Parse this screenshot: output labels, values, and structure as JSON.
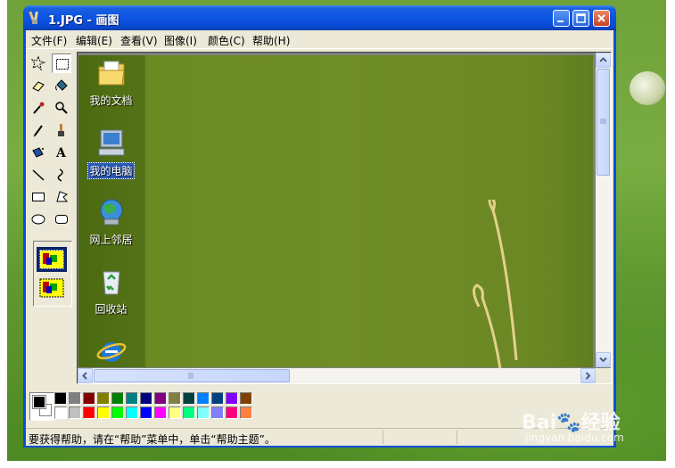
{
  "window": {
    "title": "1.JPG - 画图",
    "controls": {
      "minimize": "minimize",
      "maximize": "maximize",
      "close": "close"
    }
  },
  "menu": {
    "items": [
      "文件(F)",
      "编辑(E)",
      "查看(V)",
      "图像(I)",
      "颜色(C)",
      "帮助(H)"
    ]
  },
  "toolbox": {
    "tools": [
      "free-select-icon",
      "rect-select-icon",
      "eraser-icon",
      "fill-icon",
      "picker-icon",
      "magnifier-icon",
      "pencil-icon",
      "brush-icon",
      "airbrush-icon",
      "text-icon",
      "line-icon",
      "curve-icon",
      "rectangle-icon",
      "polygon-icon",
      "ellipse-icon",
      "rounded-rect-icon"
    ],
    "active_tool": "rect-select-icon"
  },
  "canvas": {
    "desktop_icons": [
      {
        "label": "我的文档",
        "icon": "my-documents-icon"
      },
      {
        "label": "我的电脑",
        "icon": "my-computer-icon"
      },
      {
        "label": "网上邻居",
        "icon": "network-icon"
      },
      {
        "label": "回收站",
        "icon": "recycle-bin-icon"
      },
      {
        "label": "",
        "icon": "internet-explorer-icon"
      }
    ]
  },
  "palette": {
    "foreground": "#000000",
    "background": "#ffffff",
    "row1": [
      "#000000",
      "#808080",
      "#800000",
      "#808000",
      "#008000",
      "#008080",
      "#000080",
      "#800080",
      "#808040",
      "#004040",
      "#0080ff",
      "#004080",
      "#8000ff",
      "#804000"
    ],
    "row2": [
      "#ffffff",
      "#c0c0c0",
      "#ff0000",
      "#ffff00",
      "#00ff00",
      "#00ffff",
      "#0000ff",
      "#ff00ff",
      "#ffff80",
      "#00ff80",
      "#80ffff",
      "#8080ff",
      "#ff0080",
      "#ff8040"
    ]
  },
  "status": {
    "text": "要获得帮助，请在“帮助”菜单中，单击“帮助主题”。"
  },
  "watermark": {
    "logo": "Bai",
    "logo_suffix": "经验",
    "url": "jingyan.baidu.com"
  }
}
